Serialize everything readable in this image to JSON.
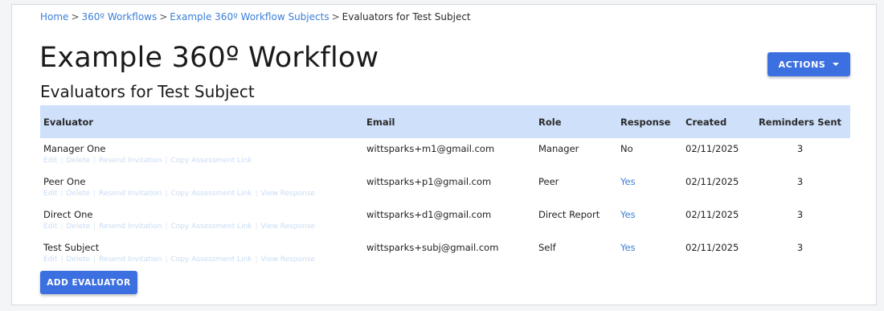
{
  "breadcrumb": {
    "items": [
      "Home",
      "360º Workflows",
      "Example 360º Workflow Subjects"
    ],
    "separator": ">",
    "current": "Evaluators for Test Subject"
  },
  "page": {
    "title": "Example 360º Workflow",
    "subtitle": "Evaluators for Test Subject"
  },
  "actions_button": {
    "label": "ACTIONS",
    "icon": "caret-down-icon"
  },
  "table": {
    "headers": [
      "Evaluator",
      "Email",
      "Role",
      "Response",
      "Created",
      "Reminders Sent"
    ],
    "row_actions": [
      "Edit",
      "Delete",
      "Resend Invitation",
      "Copy Assessment Link",
      "View Response"
    ],
    "rows": [
      {
        "evaluator": "Manager One",
        "email": "wittsparks+m1@gmail.com",
        "role": "Manager",
        "response": "No",
        "created": "02/11/2025",
        "reminders": "3"
      },
      {
        "evaluator": "Peer One",
        "email": "wittsparks+p1@gmail.com",
        "role": "Peer",
        "response": "Yes",
        "created": "02/11/2025",
        "reminders": "3"
      },
      {
        "evaluator": "Direct One",
        "email": "wittsparks+d1@gmail.com",
        "role": "Direct Report",
        "response": "Yes",
        "created": "02/11/2025",
        "reminders": "3"
      },
      {
        "evaluator": "Test Subject",
        "email": "wittsparks+subj@gmail.com",
        "role": "Self",
        "response": "Yes",
        "created": "02/11/2025",
        "reminders": "3"
      }
    ]
  },
  "add_evaluator_button": {
    "label": "ADD EVALUATOR"
  },
  "colors": {
    "accent": "#3c6fe0",
    "link": "#3a7fd8",
    "header_bg": "#cfe0fa"
  }
}
